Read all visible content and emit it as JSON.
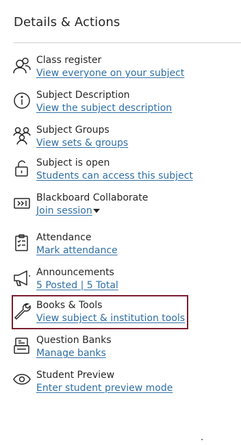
{
  "panel": {
    "title": "Details & Actions"
  },
  "items": [
    {
      "title": "Class register",
      "link": "View everyone on your subject",
      "icon": "people-icon"
    },
    {
      "title": "Subject Description",
      "link": "View the subject description",
      "icon": "info-icon"
    },
    {
      "title": "Subject Groups",
      "link": "View sets & groups",
      "icon": "groups-icon"
    },
    {
      "title": "Subject is open",
      "link": "Students can access this subject",
      "icon": "unlock-icon"
    },
    {
      "title": "Blackboard Collaborate",
      "link": "Join session",
      "icon": "video-icon"
    },
    {
      "title": "Attendance",
      "link": "Mark attendance",
      "icon": "attendance-icon"
    },
    {
      "title": "Announcements",
      "link": "5 Posted | 5 Total",
      "icon": "megaphone-icon"
    },
    {
      "title": "Books & Tools",
      "link": "View subject & institution tools",
      "icon": "wrench-icon"
    },
    {
      "title": "Question Banks",
      "link": "Manage banks",
      "icon": "question-bank-icon"
    },
    {
      "title": "Student Preview",
      "link": "Enter student preview mode",
      "icon": "eye-icon"
    }
  ],
  "colors": {
    "link": "#2f6fa5",
    "highlight_border": "#7a1c2e",
    "text": "#262626"
  }
}
